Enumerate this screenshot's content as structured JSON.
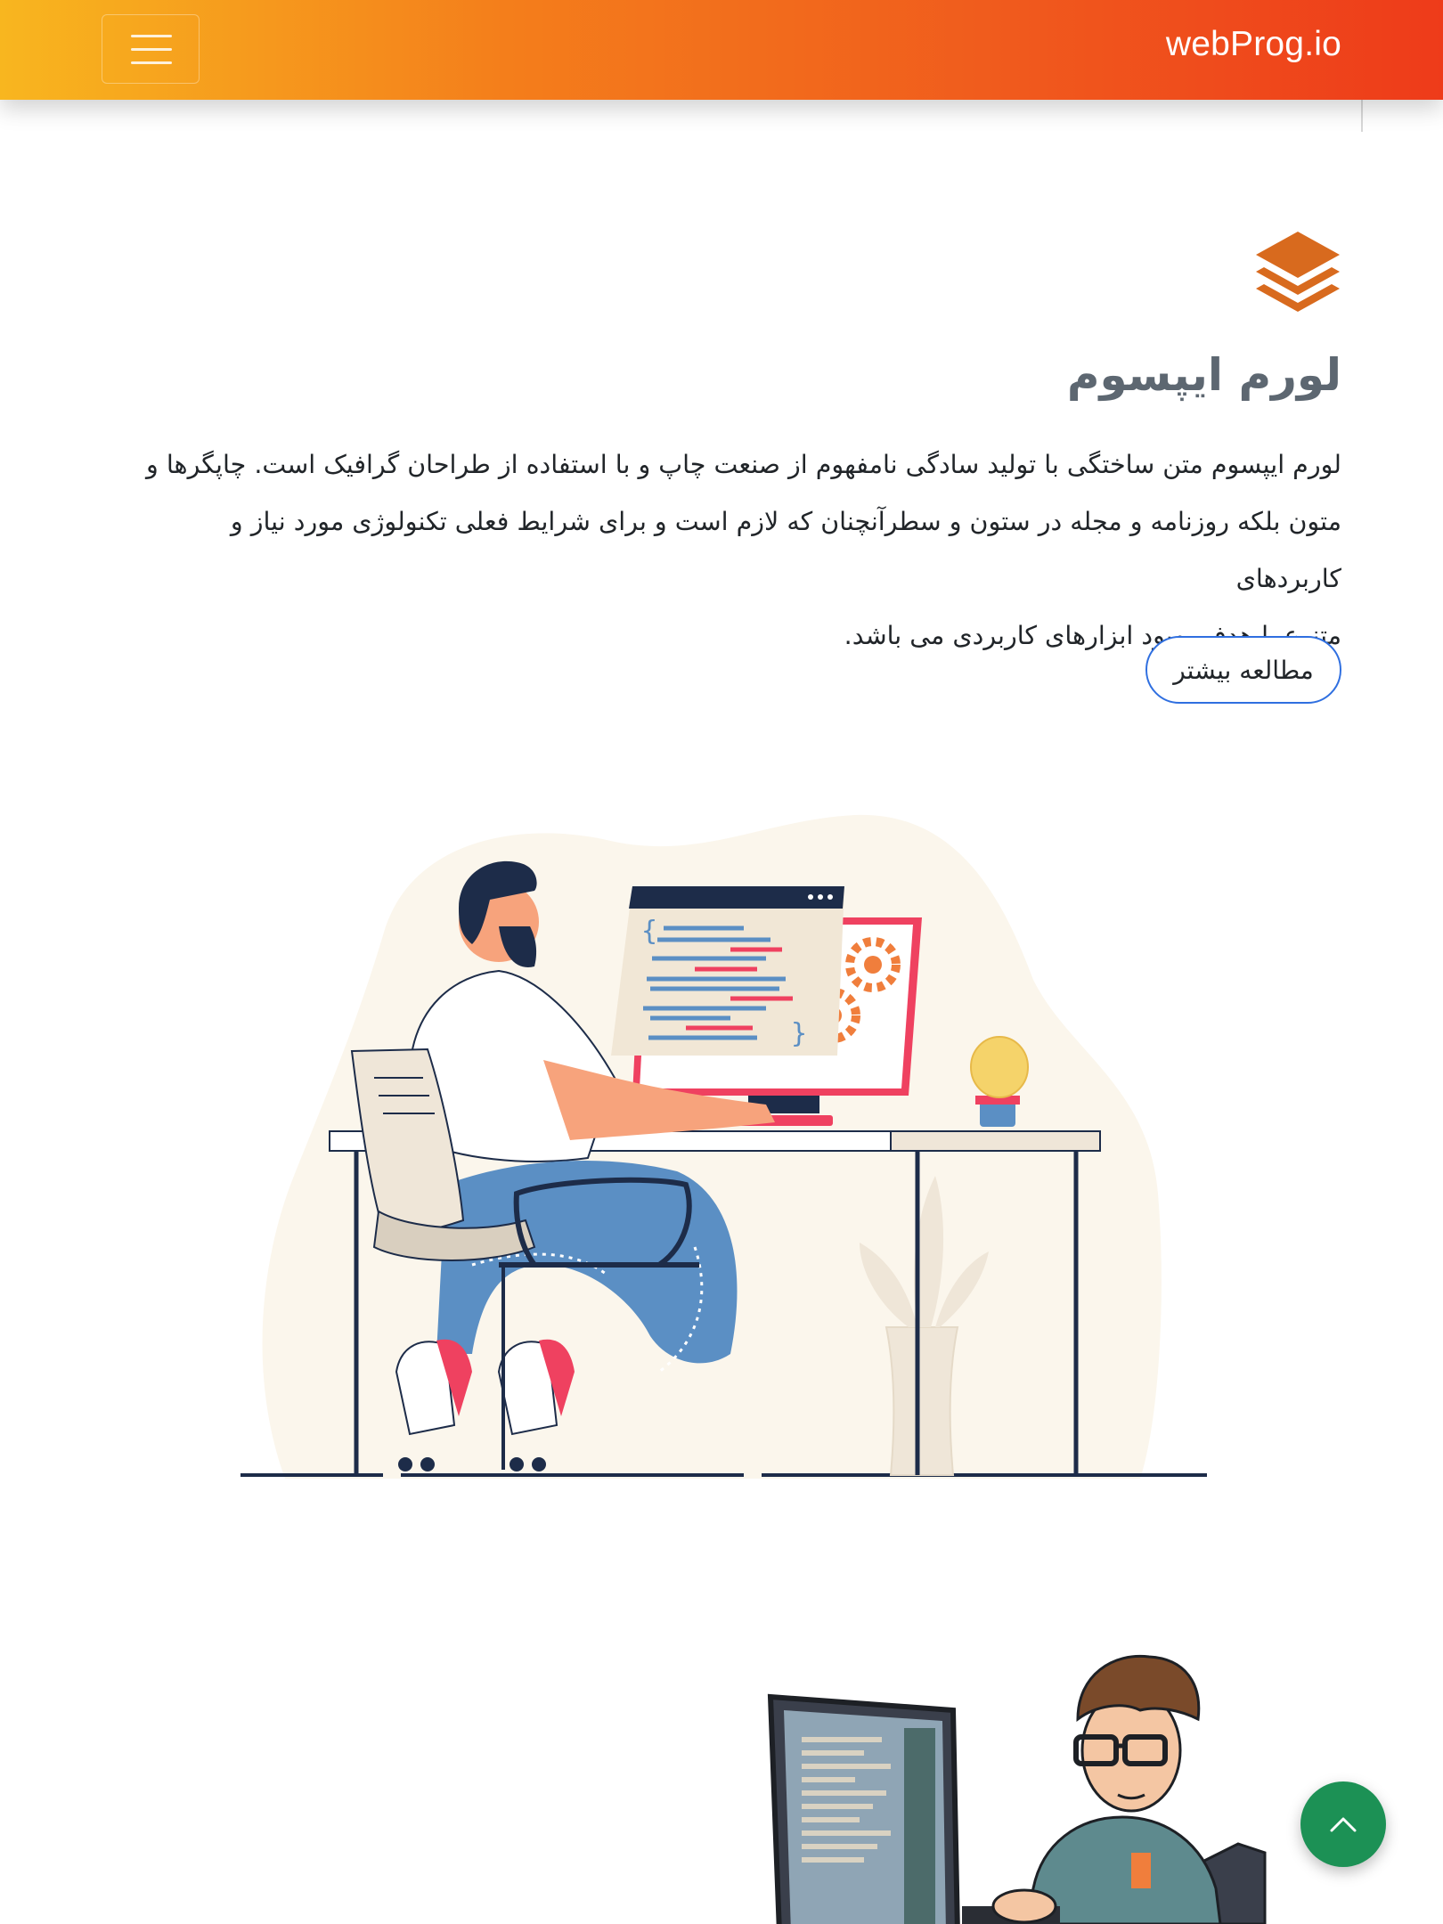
{
  "navbar": {
    "brand": "webProg.io",
    "menu_icon": "hamburger-icon"
  },
  "feature": {
    "icon": "layers-stack-icon",
    "icon_color": "#d86a1e",
    "title": "لورم ایپسوم",
    "lines": [
      "لورم ایپسوم متن ساختگی با تولید سادگی نامفهوم از صنعت چاپ و با استفاده از طراحان گرافیک است. چاپگرها و",
      "متون بلکه روزنامه و مجله در ستون و سطرآنچنان که لازم است و برای شرایط فعلی تکنولوژی مورد نیاز و کاربردهای",
      "متنوع با هدف بهبود ابزارهای کاربردی می باشد."
    ],
    "button_label": "مطالعه بیشتر",
    "button_border_color": "#2f6fe0"
  },
  "illustrations": {
    "first": "developer-at-desk-illustration",
    "second": "programmer-at-monitor-illustration"
  },
  "scroll_top": {
    "icon": "chevron-up-icon",
    "color": "#1c9155"
  }
}
